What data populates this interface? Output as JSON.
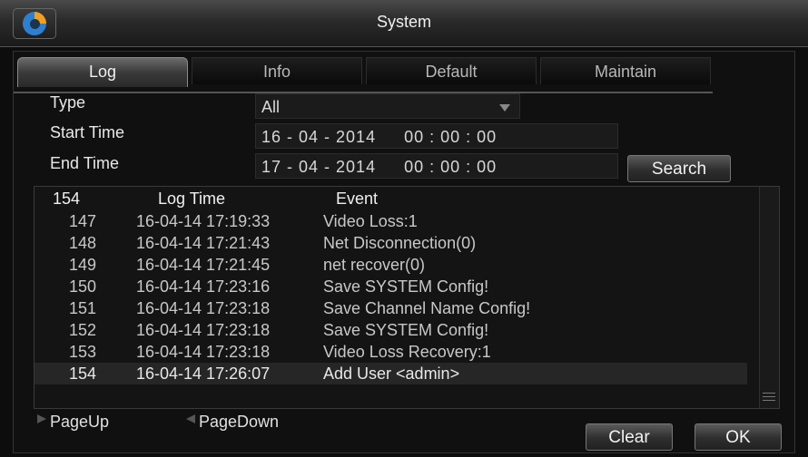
{
  "window": {
    "title": "System",
    "logo_icon": "app-logo-icon"
  },
  "tabs": [
    {
      "label": "Log",
      "active": true
    },
    {
      "label": "Info",
      "active": false
    },
    {
      "label": "Default",
      "active": false
    },
    {
      "label": "Maintain",
      "active": false
    }
  ],
  "filters": {
    "type_label": "Type",
    "type_value": "All",
    "start_label": "Start Time",
    "start_date": "16 - 04 - 2014",
    "start_time": "00 : 00 : 00",
    "end_label": "End Time",
    "end_date": "17 - 04 - 2014",
    "end_time": "00 : 00 : 00",
    "search_label": "Search"
  },
  "log": {
    "header": {
      "count": "154",
      "time": "Log Time",
      "event": "Event"
    },
    "rows": [
      {
        "id": "147",
        "time": "16-04-14 17:19:33",
        "event": "Video Loss:1"
      },
      {
        "id": "148",
        "time": "16-04-14 17:21:43",
        "event": "Net Disconnection(0)"
      },
      {
        "id": "149",
        "time": "16-04-14 17:21:45",
        "event": "net recover(0)"
      },
      {
        "id": "150",
        "time": "16-04-14 17:23:16",
        "event": "Save SYSTEM Config!"
      },
      {
        "id": "151",
        "time": "16-04-14 17:23:18",
        "event": "Save Channel Name Config!"
      },
      {
        "id": "152",
        "time": "16-04-14 17:23:18",
        "event": "Save SYSTEM Config!"
      },
      {
        "id": "153",
        "time": "16-04-14 17:23:18",
        "event": "Video Loss Recovery:1"
      },
      {
        "id": "154",
        "time": "16-04-14 17:26:07",
        "event": "Add User <admin>"
      }
    ]
  },
  "footer": {
    "page_up": "PageUp",
    "page_down": "PageDown",
    "clear": "Clear",
    "ok": "OK"
  }
}
